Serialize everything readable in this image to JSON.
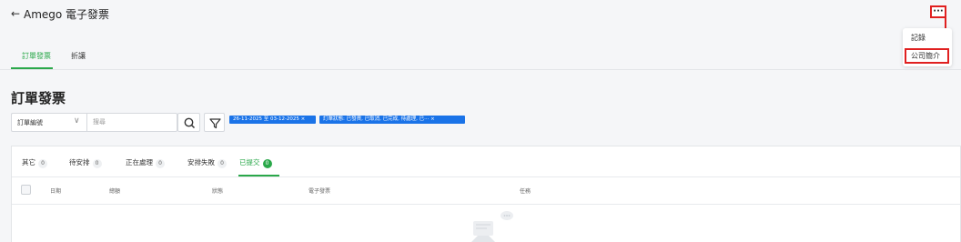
{
  "header": {
    "back_icon": "arrow-left-icon",
    "title": "Amego 電子發票",
    "more_label": "···"
  },
  "menu": {
    "items": [
      {
        "label": "記錄"
      },
      {
        "label": "公司簡介"
      }
    ]
  },
  "tabs": [
    {
      "label": "訂單發票",
      "active": true
    },
    {
      "label": "折讓",
      "active": false
    }
  ],
  "page": {
    "title": "訂單發票"
  },
  "filters": {
    "field_select": "訂單編號",
    "search_placeholder": "搜尋",
    "chips": [
      "26-11-2025 至 03-12-2025 ×",
      "訂單狀態: 已發貨, 已取消, 已完成, 待處理, 已··· ×"
    ]
  },
  "status_tabs": [
    {
      "label": "其它",
      "count": "0"
    },
    {
      "label": "待安排",
      "count": "0"
    },
    {
      "label": "正在處理",
      "count": "0"
    },
    {
      "label": "安排失敗",
      "count": "0"
    },
    {
      "label": "已提交",
      "count": "0",
      "active": true
    }
  ],
  "table": {
    "columns": [
      "日期",
      "總額",
      "狀態",
      "電子發票",
      "任務"
    ]
  },
  "colors": {
    "accent": "#2aa84a",
    "chip": "#1a73e8",
    "highlight": "#e02020"
  }
}
